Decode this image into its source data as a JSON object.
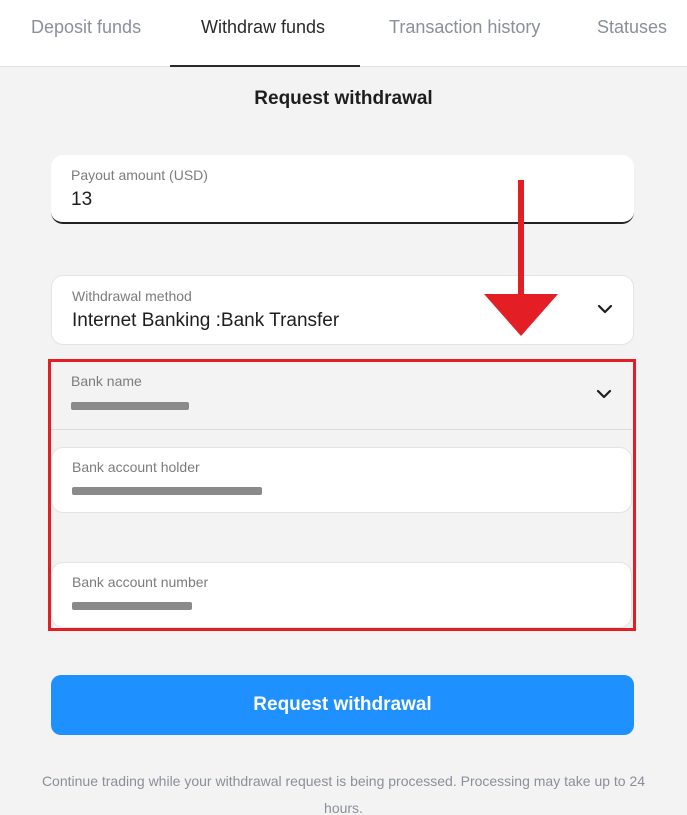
{
  "tabs": [
    {
      "label": "Deposit funds"
    },
    {
      "label": "Withdraw funds",
      "active": true
    },
    {
      "label": "Transaction history"
    },
    {
      "label": "Statuses"
    }
  ],
  "title": "Request withdrawal",
  "form": {
    "payout": {
      "label": "Payout amount (USD)",
      "value": "13"
    },
    "method": {
      "label": "Withdrawal method",
      "value": "Internet Banking :Bank Transfer"
    },
    "bank_name": {
      "label": "Bank name"
    },
    "account_holder": {
      "label": "Bank account holder"
    },
    "account_number": {
      "label": "Bank account number"
    }
  },
  "submit_label": "Request withdrawal",
  "note": "Continue trading while your withdrawal request is being processed.  Processing may take up to 24 hours.",
  "colors": {
    "accent": "#1e90ff",
    "highlight": "#e31e24"
  },
  "icons": {
    "dropdown": "chevron-down-icon",
    "annotation": "arrow-down-icon"
  }
}
